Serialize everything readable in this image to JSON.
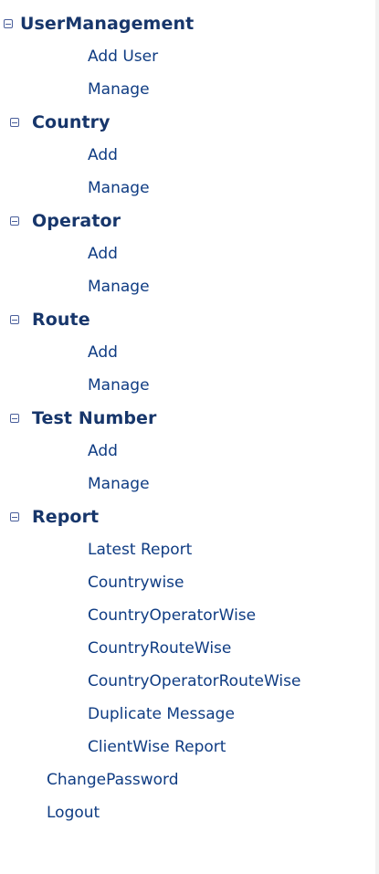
{
  "menu": {
    "sections": [
      {
        "title": "UserManagement",
        "items": [
          "Add User",
          "Manage"
        ]
      },
      {
        "title": "Country",
        "items": [
          "Add",
          "Manage"
        ]
      },
      {
        "title": "Operator",
        "items": [
          "Add",
          "Manage"
        ]
      },
      {
        "title": "Route",
        "items": [
          "Add",
          "Manage"
        ]
      },
      {
        "title": "Test Number",
        "items": [
          "Add",
          "Manage"
        ]
      },
      {
        "title": "Report",
        "items": [
          "Latest Report",
          "Countrywise",
          "CountryOperatorWise",
          "CountryRouteWise",
          "CountryOperatorRouteWise",
          "Duplicate Message",
          "ClientWise Report"
        ]
      }
    ],
    "bottom_links": [
      "ChangePassword",
      "Logout"
    ],
    "icons": {
      "section_toggle": "collapse-minus-icon"
    },
    "colors": {
      "section": "#17366b",
      "link": "#0f3c83",
      "toggle": "#4a5f9b"
    }
  }
}
